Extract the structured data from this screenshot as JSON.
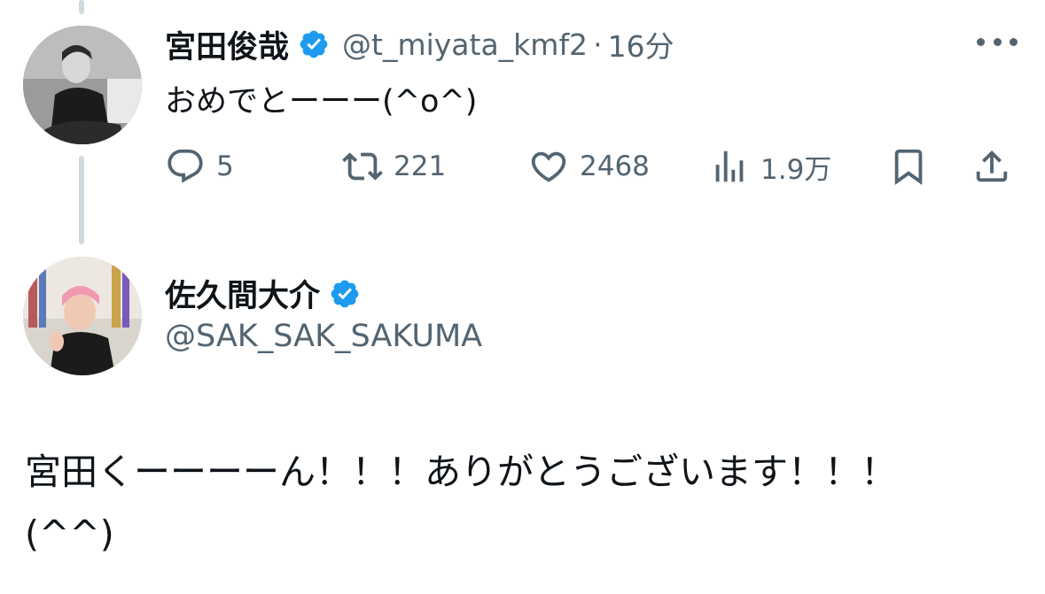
{
  "colors": {
    "verified_blue": "#1d9bf0",
    "muted_text": "#536471",
    "primary_text": "#0f1419",
    "thread_line": "#cfd9de"
  },
  "tweet": {
    "author_name": "宮田俊哉",
    "verified_icon": "verified-badge-icon",
    "handle": "@t_miyata_kmf2",
    "separator": "·",
    "time": "16分",
    "text": "おめでとーーー(^o^)",
    "actions": {
      "reply": {
        "icon": "reply-icon",
        "count": "5"
      },
      "retweet": {
        "icon": "retweet-icon",
        "count": "221"
      },
      "like": {
        "icon": "heart-icon",
        "count": "2468"
      },
      "views": {
        "icon": "views-icon",
        "count": "1.9万"
      },
      "bookmark": {
        "icon": "bookmark-icon"
      },
      "share": {
        "icon": "share-icon"
      }
    }
  },
  "reply": {
    "author_name": "佐久間大介",
    "verified_icon": "verified-badge-icon",
    "handle": "@SAK_SAK_SAKUMA",
    "text_line1": "宮田くーーーーん！！！ありがとうございます！！！",
    "text_line2": "(^^)"
  }
}
